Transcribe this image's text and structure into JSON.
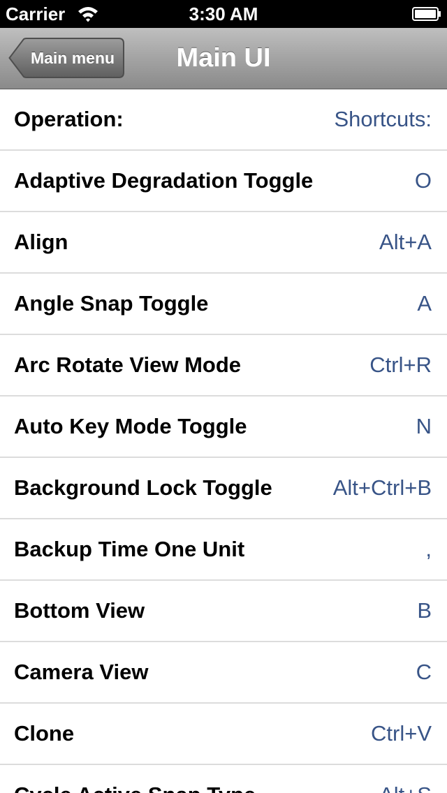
{
  "status_bar": {
    "carrier": "Carrier",
    "time": "3:30 AM",
    "icons": [
      "wifi-icon",
      "battery-icon"
    ]
  },
  "nav_bar": {
    "back_label": "Main menu",
    "title": "Main UI"
  },
  "table": {
    "header": {
      "title": "Operation:",
      "value": "Shortcuts:"
    },
    "rows": [
      {
        "title": "Adaptive Degradation Toggle",
        "value": "O"
      },
      {
        "title": "Align",
        "value": "Alt+A"
      },
      {
        "title": "Angle Snap Toggle",
        "value": "A"
      },
      {
        "title": "Arc Rotate View Mode",
        "value": "Ctrl+R"
      },
      {
        "title": "Auto Key Mode Toggle",
        "value": "N"
      },
      {
        "title": "Background Lock Toggle",
        "value": "Alt+Ctrl+B"
      },
      {
        "title": "Backup Time One Unit",
        "value": ","
      },
      {
        "title": "Bottom View",
        "value": "B"
      },
      {
        "title": "Camera View",
        "value": "C"
      },
      {
        "title": "Clone",
        "value": "Ctrl+V"
      },
      {
        "title": "Cycle Active Snap Type",
        "value": "Alt+S"
      }
    ]
  },
  "colors": {
    "detail_text": "#385487",
    "separator": "#dcdcdc",
    "nav_gradient_top": "#bfbfbf",
    "nav_gradient_bottom": "#8a8a8a"
  }
}
